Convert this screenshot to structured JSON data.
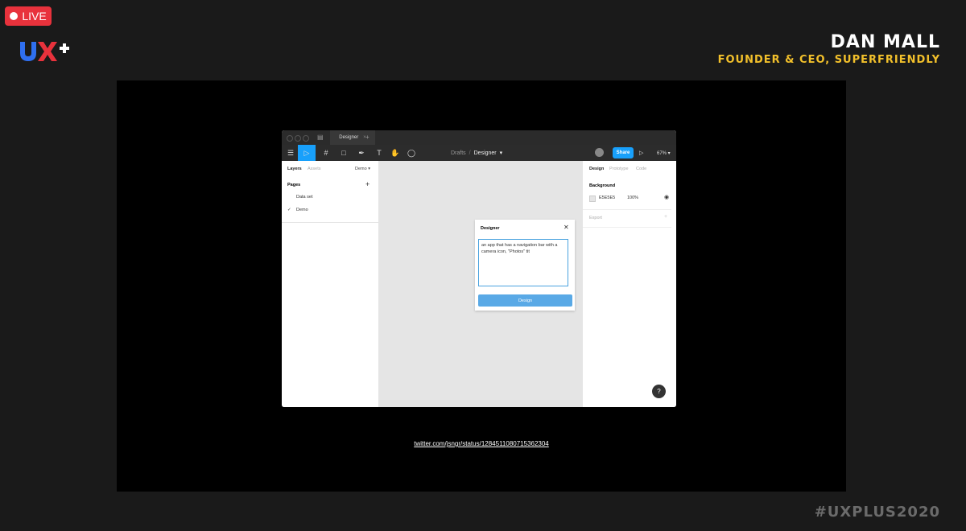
{
  "overlay": {
    "live_label": "LIVE",
    "logo_text": "UX+",
    "speaker_name": "DAN MALL",
    "speaker_role": "FOUNDER & CEO, SUPERFRIENDLY",
    "hashtag": "#UXPLUS2020",
    "colors": {
      "live": "#e8323c",
      "role": "#f2c02b"
    }
  },
  "slide": {
    "link": "twitter.com/jsngr/status/1284511080715362304"
  },
  "app": {
    "tab_title": "Designer",
    "tab_close": "×",
    "new_tab": "+",
    "breadcrumb": {
      "project": "Drafts",
      "separator": "/",
      "file": "Designer",
      "chevron": "▾"
    },
    "share_label": "Share",
    "play_icon": "▷",
    "zoom": "67% ▾",
    "tools": {
      "menu": "☰",
      "move": "▷",
      "frame": "#",
      "shape": "□",
      "pen": "✒",
      "text": "T",
      "hand": "✋",
      "comment": "◯"
    },
    "left_panel": {
      "tabs": [
        "Layers",
        "Assets"
      ],
      "page_select": "Demo ▾",
      "pages_heading": "Pages",
      "add": "+",
      "pages": [
        {
          "label": "Data set",
          "check": ""
        },
        {
          "label": "Demo",
          "check": "✓"
        }
      ]
    },
    "dialog": {
      "title": "Designer",
      "close": "✕",
      "input_text": "an app that has a navigation bar with a camera icon, \"Photos\" tit",
      "button": "Design"
    },
    "right_panel": {
      "tabs": [
        "Design",
        "Prototype",
        "Code"
      ],
      "background_heading": "Background",
      "bg_hex": "E5E5E5",
      "bg_opacity": "100%",
      "export_heading": "Export",
      "export_add": "+"
    },
    "help": "?",
    "accent": "#18a0fb"
  }
}
